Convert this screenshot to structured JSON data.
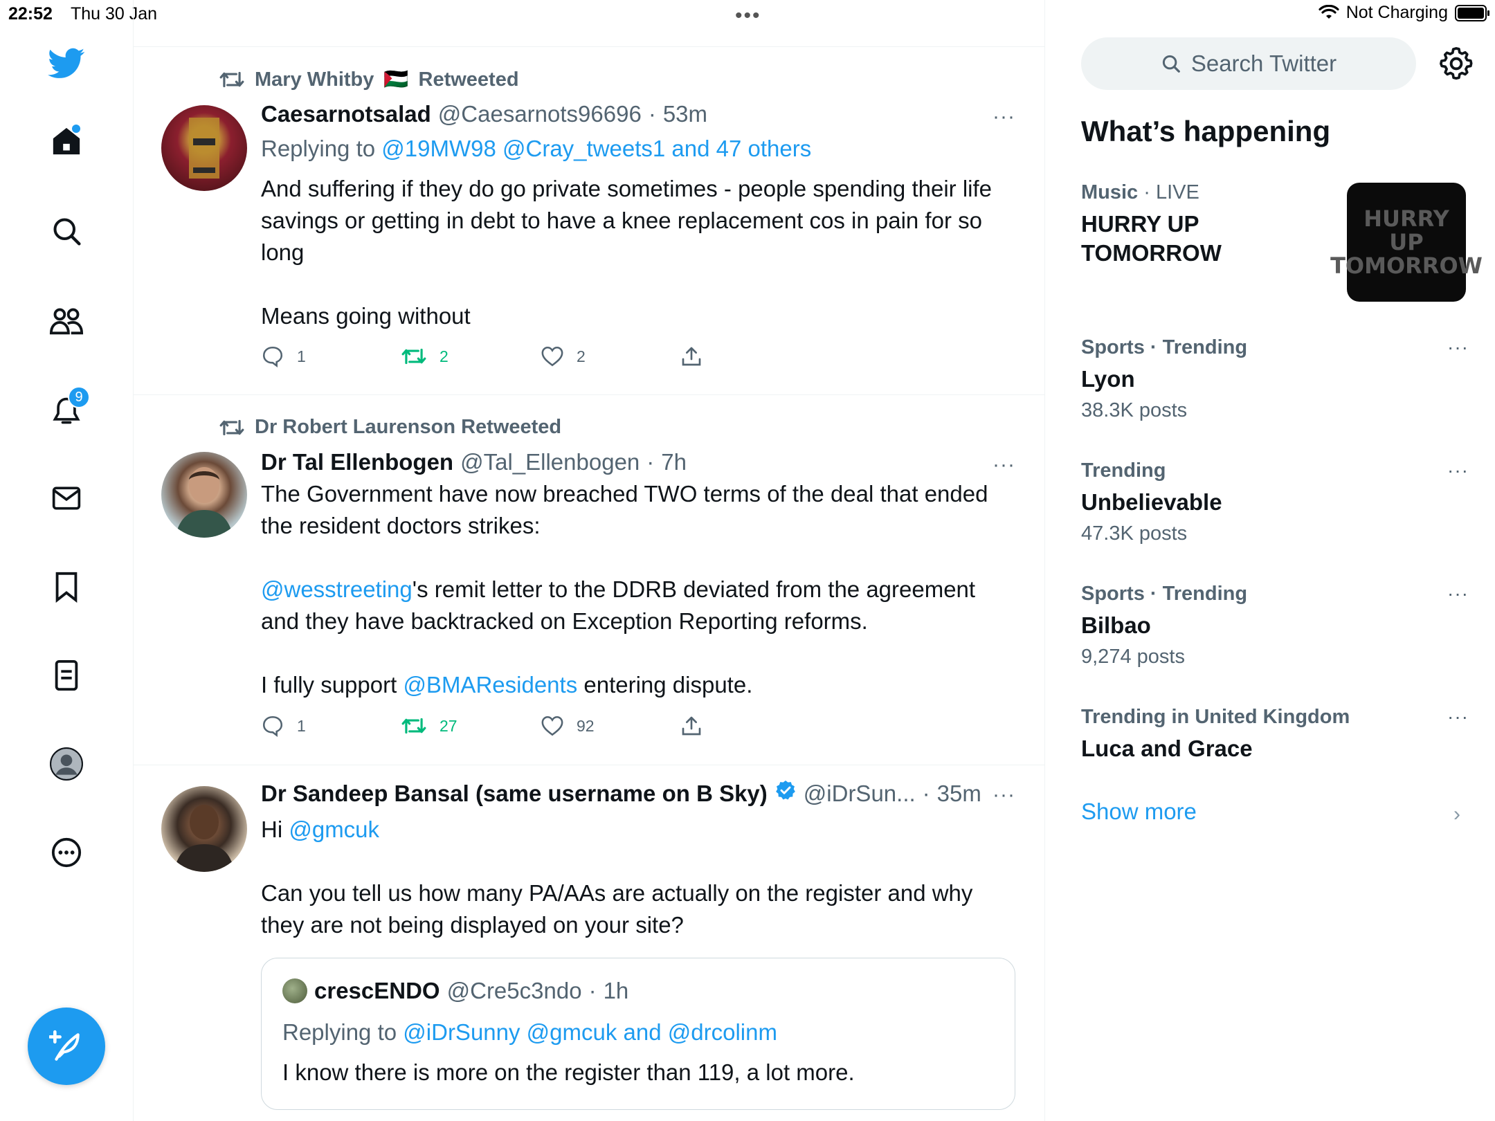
{
  "status_bar": {
    "time": "22:52",
    "date": "Thu 30 Jan",
    "charging": "Not Charging",
    "multitask": "•••"
  },
  "nav": {
    "items": [
      {
        "name": "home",
        "icon": "home-icon"
      },
      {
        "name": "explore",
        "icon": "search-icon"
      },
      {
        "name": "communities",
        "icon": "people-icon"
      },
      {
        "name": "notifications",
        "icon": "bell-icon",
        "badge": "9"
      },
      {
        "name": "messages",
        "icon": "mail-icon"
      },
      {
        "name": "bookmarks",
        "icon": "bookmark-icon"
      },
      {
        "name": "lists",
        "icon": "list-icon"
      },
      {
        "name": "profile",
        "icon": "avatar-icon"
      },
      {
        "name": "more",
        "icon": "more-circle-icon"
      }
    ],
    "compose_icon": "feather-plus-icon",
    "brand_color": "#1d9bf0"
  },
  "tweets": [
    {
      "retweeted_by": "Mary Whitby",
      "retweeted_flag": "🇵🇸",
      "retweeted_label": "Retweeted",
      "name": "Caesarnotsalad",
      "handle": "@Caesarnots96696",
      "sep": "·",
      "time": "53m",
      "replying_prefix": "Replying to",
      "replying_links": "@19MW98 @Cray_tweets1 and 47 others",
      "body": [
        "And suffering if they do go private sometimes - people spending their life savings or getting in debt to have a knee replacement cos in pain for so long",
        "",
        "Means going without"
      ],
      "replies": "1",
      "retweets": "2",
      "likes": "2"
    },
    {
      "retweeted_by": "Dr Robert Laurenson Retweeted",
      "name": "Dr Tal Ellenbogen",
      "handle": "@Tal_Ellenbogen",
      "sep": "·",
      "time": "7h",
      "body_line1": "The Government have now breached TWO terms of the deal that ended the resident doctors strikes:",
      "mention1": "@wesstreeting",
      "body_line2": "'s remit letter to the DDRB deviated from the agreement and they have backtracked on Exception Reporting reforms.",
      "body_line3_pre": "I fully support ",
      "mention2": "@BMAResidents",
      "body_line3_post": " entering dispute.",
      "replies": "1",
      "retweets": "27",
      "likes": "92"
    },
    {
      "name": "Dr Sandeep Bansal (same username on B Sky)",
      "verified": true,
      "handle": "@iDrSun...",
      "sep": "·",
      "time": "35m",
      "greeting": "Hi ",
      "mention": "@gmcuk",
      "body": "Can you tell us how many PA/AAs are actually on the register and why they are not being displayed on your site?",
      "quote": {
        "name": "crescENDO",
        "handle": "@Cre5c3ndo",
        "sep": "·",
        "time": "1h",
        "replying_prefix": "Replying to",
        "replying_links": "@iDrSunny @gmcuk and @drcolinm",
        "body": "I know there is more on the register than 119, a lot more."
      }
    }
  ],
  "sidebar": {
    "search_placeholder": "Search Twitter",
    "section_title": "What’s happening",
    "live": {
      "category": "Music",
      "sep": " · ",
      "status": "LIVE",
      "title": "HURRY UP TOMORROW",
      "image_line1": "HURRY UP",
      "image_line2": "TOMORROW"
    },
    "trends": [
      {
        "meta": "Sports · Trending",
        "title": "Lyon",
        "count": "38.3K posts"
      },
      {
        "meta": "Trending",
        "title": "Unbelievable",
        "count": "47.3K posts"
      },
      {
        "meta": "Sports · Trending",
        "title": "Bilbao",
        "count": "9,274 posts"
      },
      {
        "meta": "Trending in United Kingdom",
        "title": "Luca and Grace",
        "count": ""
      }
    ],
    "more_glyph": "···",
    "show_more": "Show more",
    "chevron": "›"
  }
}
